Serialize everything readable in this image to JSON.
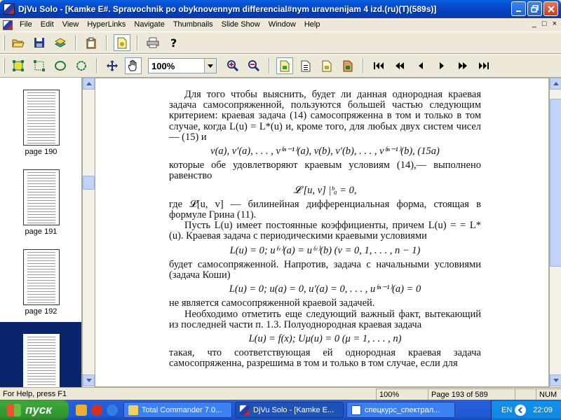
{
  "window": {
    "title": "DjVu Solo - [Kamke E#. Spravochnik po obyknovennym differencial#nym uravnenijam 4 izd.(ru)(T)(589s)]",
    "buttons": {
      "minimize": "0",
      "maximize": "1",
      "close": "r"
    }
  },
  "menu": {
    "items": [
      "File",
      "Edit",
      "View",
      "HyperLinks",
      "Navigate",
      "Thumbnails",
      "Slide Show",
      "Window",
      "Help"
    ],
    "mdi_controls": [
      "_",
      "□",
      "×"
    ]
  },
  "toolbar": {
    "zoom_value": "100%"
  },
  "thumbnails": {
    "items": [
      {
        "label": "page 190"
      },
      {
        "label": "page 191"
      },
      {
        "label": "page 192"
      },
      {
        "label": ""
      }
    ]
  },
  "document": {
    "p1": "Для того чтобы выяснить, будет ли данная однородная краевая задача самосопряженной, пользуются большей частью следующим критерием: краевая задача (14) самосопряженна в том и только в том случае, когда L(u) = L*(u) и, кроме того, для любых двух систем чисел — (15) и",
    "eq1": "v(a), v′(a), . . . , v⁽ⁿ⁻¹⁾(a),    v(b), v′(b), . . . , v⁽ⁿ⁻¹⁾(b),   (15a)",
    "p2": "которые обе удовлетворяют краевым условиям (14),— выполнено равенство",
    "eq2": "𝓛 [u, v] |ᵇₐ = 0,",
    "p3": "где 𝓛[u, v] — билинейная дифференциальная форма, стоящая в формуле Грина (11).",
    "p4": "Пусть L(u) имеет постоянные коэффициенты, причем L(u) = = L*(u). Краевая задача с периодическими краевыми условиями",
    "eq3": "L(u) = 0;   u⁽ᵛ⁾(a) = u⁽ᵛ⁾(b)      (v = 0, 1, . . . , n − 1)",
    "p5": "будет самосопряженной. Напротив, задача с начальными условиями (задача Коши)",
    "eq4": "L(u) = 0;   u(a) = 0,      u′(a) = 0, . . . , u⁽ⁿ⁻¹⁾(a) = 0",
    "p6": "не является самосопряженной краевой задачей.",
    "p7": "Необходимо отметить еще следующий важный факт, вытекающий из последней части п. 1.3. Полуоднородная краевая задача",
    "eq5": "L(u) = f(x);   Uμ(u) = 0        (μ = 1, . . . , n)",
    "p8": "такая, что соответствующая ей однородная краевая задача самосопряженна, разрешима в том и только в том случае, если для"
  },
  "status": {
    "help": "For Help, press F1",
    "zoom": "100%",
    "page": "Page 193 of 589",
    "num": "NUM"
  },
  "taskbar": {
    "start_label": "пуск",
    "tasks": [
      {
        "label": "Total Commander 7.0..."
      },
      {
        "label": "DjVu Solo - [Kamke E..."
      },
      {
        "label": "спецкурс_спектрал..."
      }
    ],
    "lang": "EN",
    "time": "22:09"
  },
  "colors": {
    "title_bar": "#0447C9",
    "selection": "#0A246A",
    "start_button": "#39A739"
  }
}
